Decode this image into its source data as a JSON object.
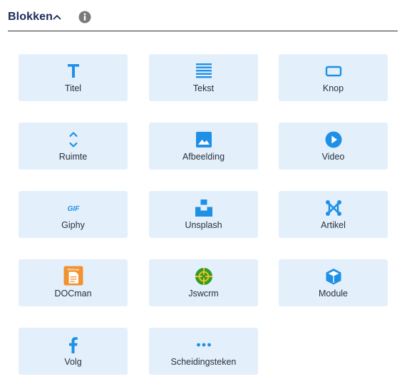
{
  "header": {
    "title": "Blokken",
    "toggle_icon": "chevron-up-icon",
    "info_icon": "info-icon"
  },
  "colors": {
    "accent": "#1e90e6",
    "tile_background": "#e3f0fb",
    "title": "#1d2a5b",
    "docman_orange": "#f0922e",
    "jswcrm_green": "#2e9c2e"
  },
  "blocks": [
    {
      "label": "Titel",
      "icon": "title-t-icon"
    },
    {
      "label": "Tekst",
      "icon": "text-lines-icon"
    },
    {
      "label": "Knop",
      "icon": "button-icon"
    },
    {
      "label": "Ruimte",
      "icon": "spacer-arrows-icon"
    },
    {
      "label": "Afbeelding",
      "icon": "image-icon"
    },
    {
      "label": "Video",
      "icon": "play-circle-icon"
    },
    {
      "label": "Giphy",
      "icon": "gif-icon",
      "icon_text": "GIF"
    },
    {
      "label": "Unsplash",
      "icon": "unsplash-icon"
    },
    {
      "label": "Artikel",
      "icon": "joomla-icon"
    },
    {
      "label": "DOCman",
      "icon": "docman-icon",
      "icon_text": "DOCman"
    },
    {
      "label": "Jswcrm",
      "icon": "jswcrm-icon"
    },
    {
      "label": "Module",
      "icon": "cube-icon"
    },
    {
      "label": "Volg",
      "icon": "facebook-icon"
    },
    {
      "label": "Scheidingsteken",
      "icon": "divider-dots-icon"
    }
  ]
}
